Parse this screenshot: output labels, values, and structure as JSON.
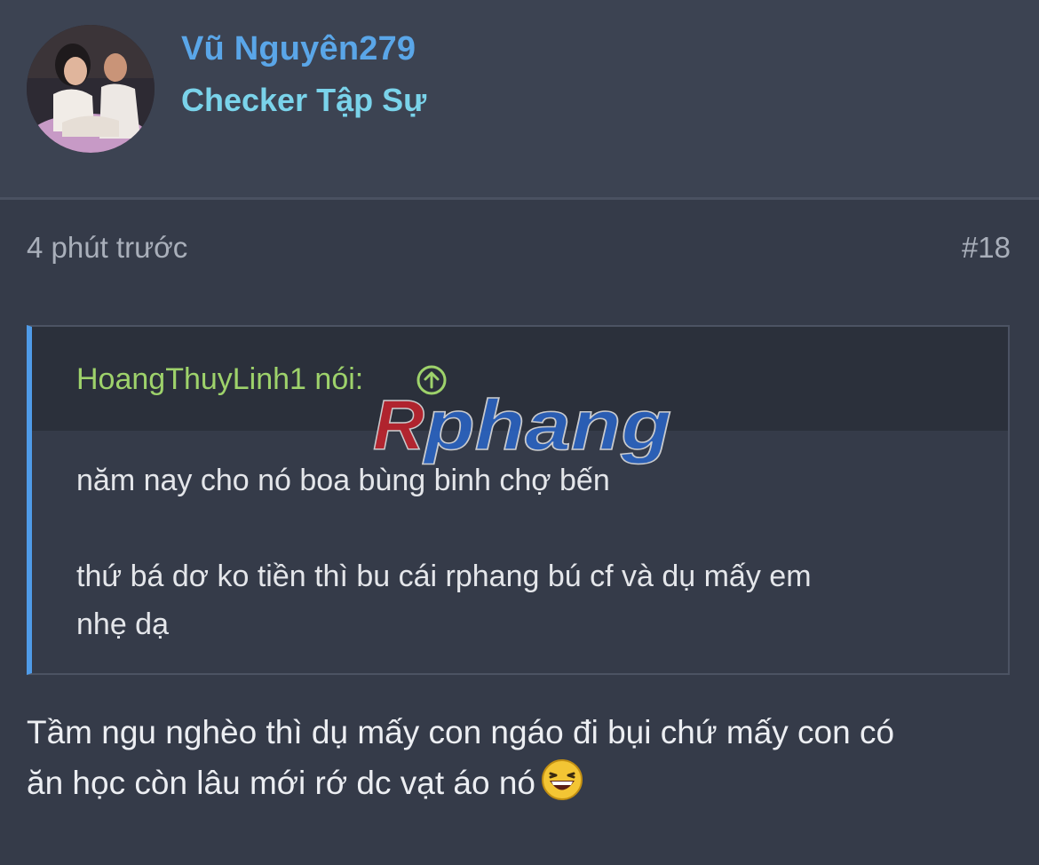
{
  "user": {
    "name": "Vũ Nguyên279",
    "title": "Checker Tập Sự"
  },
  "post": {
    "time": "4 phút trước",
    "number": "#18"
  },
  "quote": {
    "author": "HoangThuyLinh1 nói:",
    "watermark": "Rphang",
    "lines": [
      "năm nay cho nó boa bùng binh chợ bến",
      "thứ bá dơ ko tiền thì bu cái rphang bú cf và dụ mấy em",
      "nhẹ dạ"
    ]
  },
  "reply": {
    "lines": [
      "Tầm ngu nghèo thì dụ mấy con ngáo đi bụi chứ mấy con có",
      "ăn học còn lâu mới rớ dc vạt áo nó"
    ],
    "emoji": "laughing-face-icon"
  },
  "colors": {
    "background": "#353b49",
    "header": "#3c4352",
    "username": "#5aa6e8",
    "user_title": "#7ad3ea",
    "quote_author": "#9ed26b",
    "quote_border": "#4f9be8",
    "watermark_red": "#c8232c",
    "watermark_blue": "#2a66c8"
  }
}
